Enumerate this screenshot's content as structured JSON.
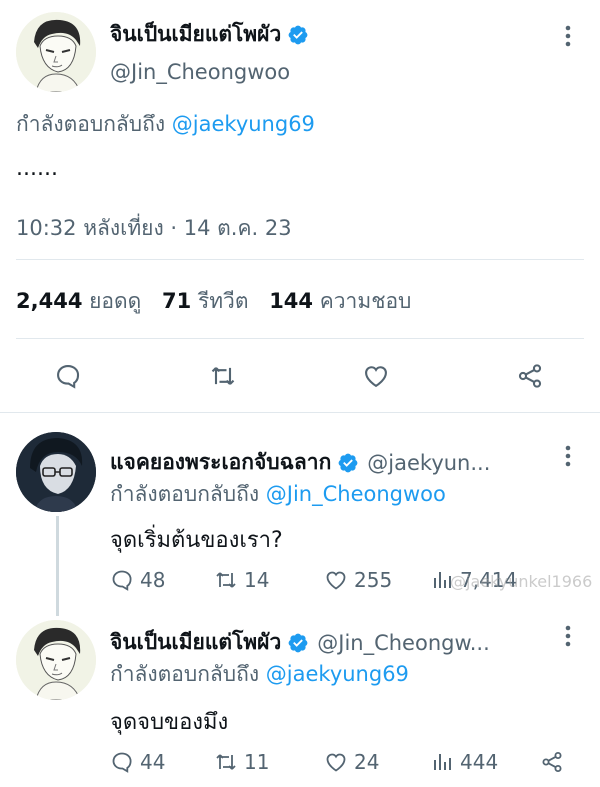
{
  "main_tweet": {
    "display_name": "จินเป็นเมียแต่โพผัว",
    "handle": "@Jin_Cheongwoo",
    "reply_prefix": "กำลังตอบกลับถึง",
    "reply_mention": "@jaekyung69",
    "body": "......",
    "timestamp": "10:32 หลังเที่ยง · 14 ต.ค. 23",
    "stats": {
      "views_count": "2,444",
      "views_label": "ยอดดู",
      "retweets_count": "71",
      "retweets_label": "รีทวีต",
      "likes_count": "144",
      "likes_label": "ความชอบ"
    }
  },
  "reply_1": {
    "display_name": "แจคยองพระเอกจับฉลาก",
    "handle": "@jaekyun...",
    "reply_prefix": "กำลังตอบกลับถึง",
    "reply_mention": "@Jin_Cheongwoo",
    "body": "จุดเริ่มต้นของเรา?",
    "replies": "48",
    "retweets": "14",
    "likes": "255",
    "views": "7,414"
  },
  "reply_2": {
    "display_name": "จินเป็นเมียแต่โพผัว",
    "handle": "@Jin_Cheongw...",
    "reply_prefix": "กำลังตอบกลับถึง",
    "reply_mention": "@jaekyung69",
    "body": "จุดจบของมึง",
    "replies": "44",
    "retweets": "11",
    "likes": "24",
    "views": "444"
  },
  "watermark": "@jaekyunkel1966",
  "colors": {
    "accent": "#1d9bf0",
    "secondary_text": "#536471",
    "primary_text": "#0f1419",
    "divider": "#e1e8ed"
  },
  "icons": [
    "verified-badge-icon",
    "more-icon",
    "reply-icon",
    "retweet-icon",
    "like-icon",
    "share-icon",
    "views-icon"
  ]
}
